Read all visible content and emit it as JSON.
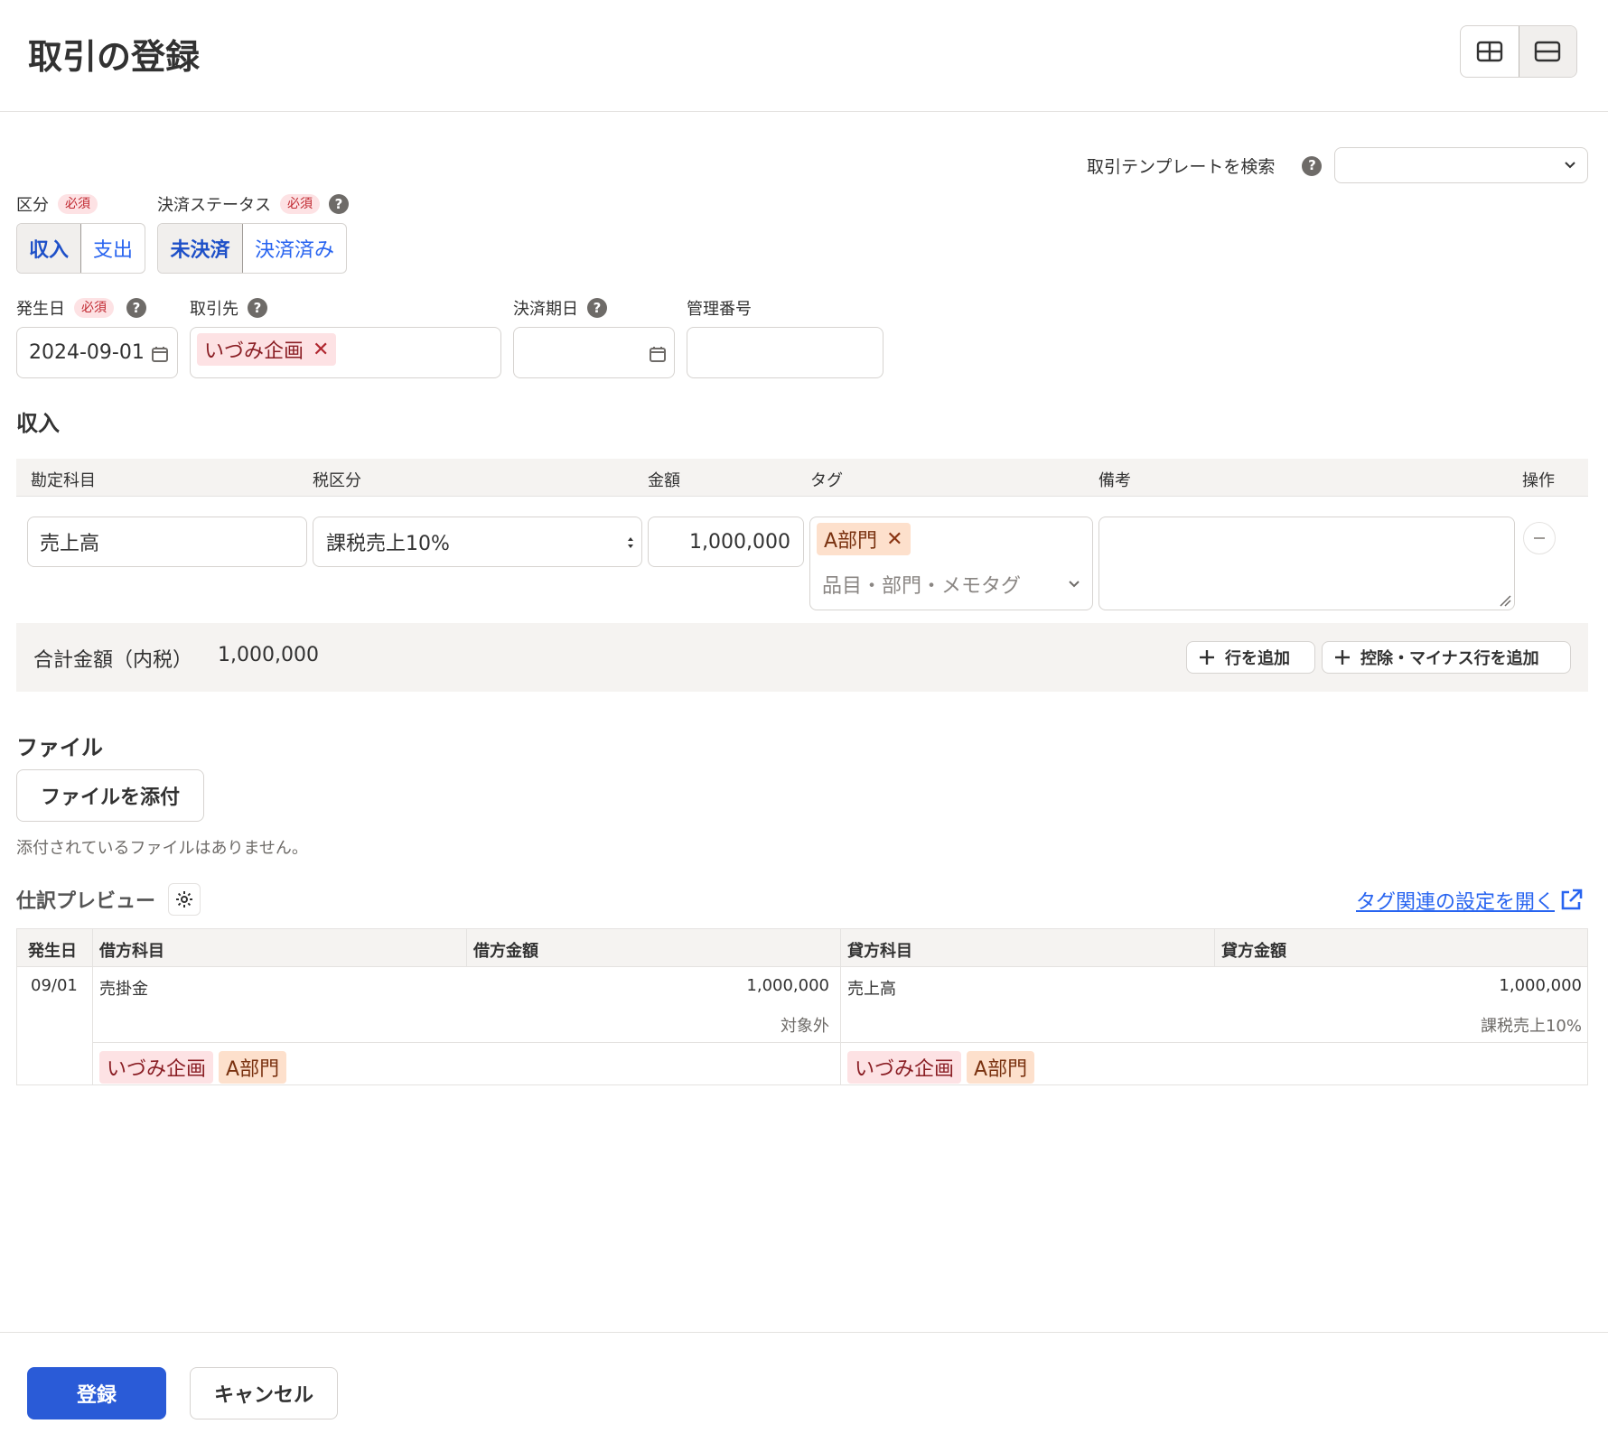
{
  "header": {
    "title": "取引の登録"
  },
  "template_search": {
    "label": "取引テンプレートを検索",
    "value": ""
  },
  "type_field": {
    "label": "区分",
    "required": "必須",
    "options": [
      "収入",
      "支出"
    ],
    "selected": "収入"
  },
  "settlement_status": {
    "label": "決済ステータス",
    "required": "必須",
    "options": [
      "未決済",
      "決済済み"
    ],
    "selected": "未決済"
  },
  "date_field": {
    "label": "発生日",
    "required": "必須",
    "value": "2024-09-01"
  },
  "partner_field": {
    "label": "取引先",
    "value": "いづみ企画"
  },
  "due_date_field": {
    "label": "決済期日",
    "value": ""
  },
  "control_number_field": {
    "label": "管理番号",
    "value": ""
  },
  "income_section": {
    "title": "収入",
    "columns": [
      "勘定科目",
      "税区分",
      "金額",
      "タグ",
      "備考",
      "操作"
    ],
    "row": {
      "account": "売上高",
      "tax_category": "課税売上10%",
      "amount": "1,000,000",
      "tag": "A部門",
      "tag_placeholder": "品目・部門・メモタグ",
      "memo": ""
    },
    "total_label": "合計金額（内税）",
    "total_value": "1,000,000",
    "add_row_label": "行を追加",
    "add_minus_row_label": "控除・マイナス行を追加"
  },
  "file_section": {
    "title": "ファイル",
    "attach_label": "ファイルを添付",
    "empty_message": "添付されているファイルはありません。"
  },
  "journal_preview": {
    "title": "仕訳プレビュー",
    "settings_link": "タグ関連の設定を開く",
    "columns": [
      "発生日",
      "借方科目",
      "借方金額",
      "貸方科目",
      "貸方金額"
    ],
    "row": {
      "date": "09/01",
      "debit_account": "売掛金",
      "debit_amount": "1,000,000",
      "debit_tax": "対象外",
      "credit_account": "売上高",
      "credit_amount": "1,000,000",
      "credit_tax": "課税売上10%",
      "debit_tags": [
        "いづみ企画",
        "A部門"
      ],
      "credit_tags": [
        "いづみ企画",
        "A部門"
      ]
    }
  },
  "footer": {
    "submit_label": "登録",
    "cancel_label": "キャンセル"
  },
  "colors": {
    "primary": "#2864F0",
    "submit_bg": "#2A5BD7",
    "required_bg": "#FDE2E4",
    "required_text": "#C0272F",
    "partner_tag_bg": "#FDE2E4",
    "department_tag_bg": "#FDE0CC",
    "table_header_bg": "#F5F3F1"
  },
  "icons": [
    "layout-split-icon",
    "layout-stacked-icon",
    "help-icon",
    "calendar-icon",
    "close-icon",
    "chevron-down-icon",
    "select-arrows-icon",
    "minus-icon",
    "plus-icon",
    "gear-icon",
    "external-link-icon",
    "resize-handle-icon"
  ]
}
